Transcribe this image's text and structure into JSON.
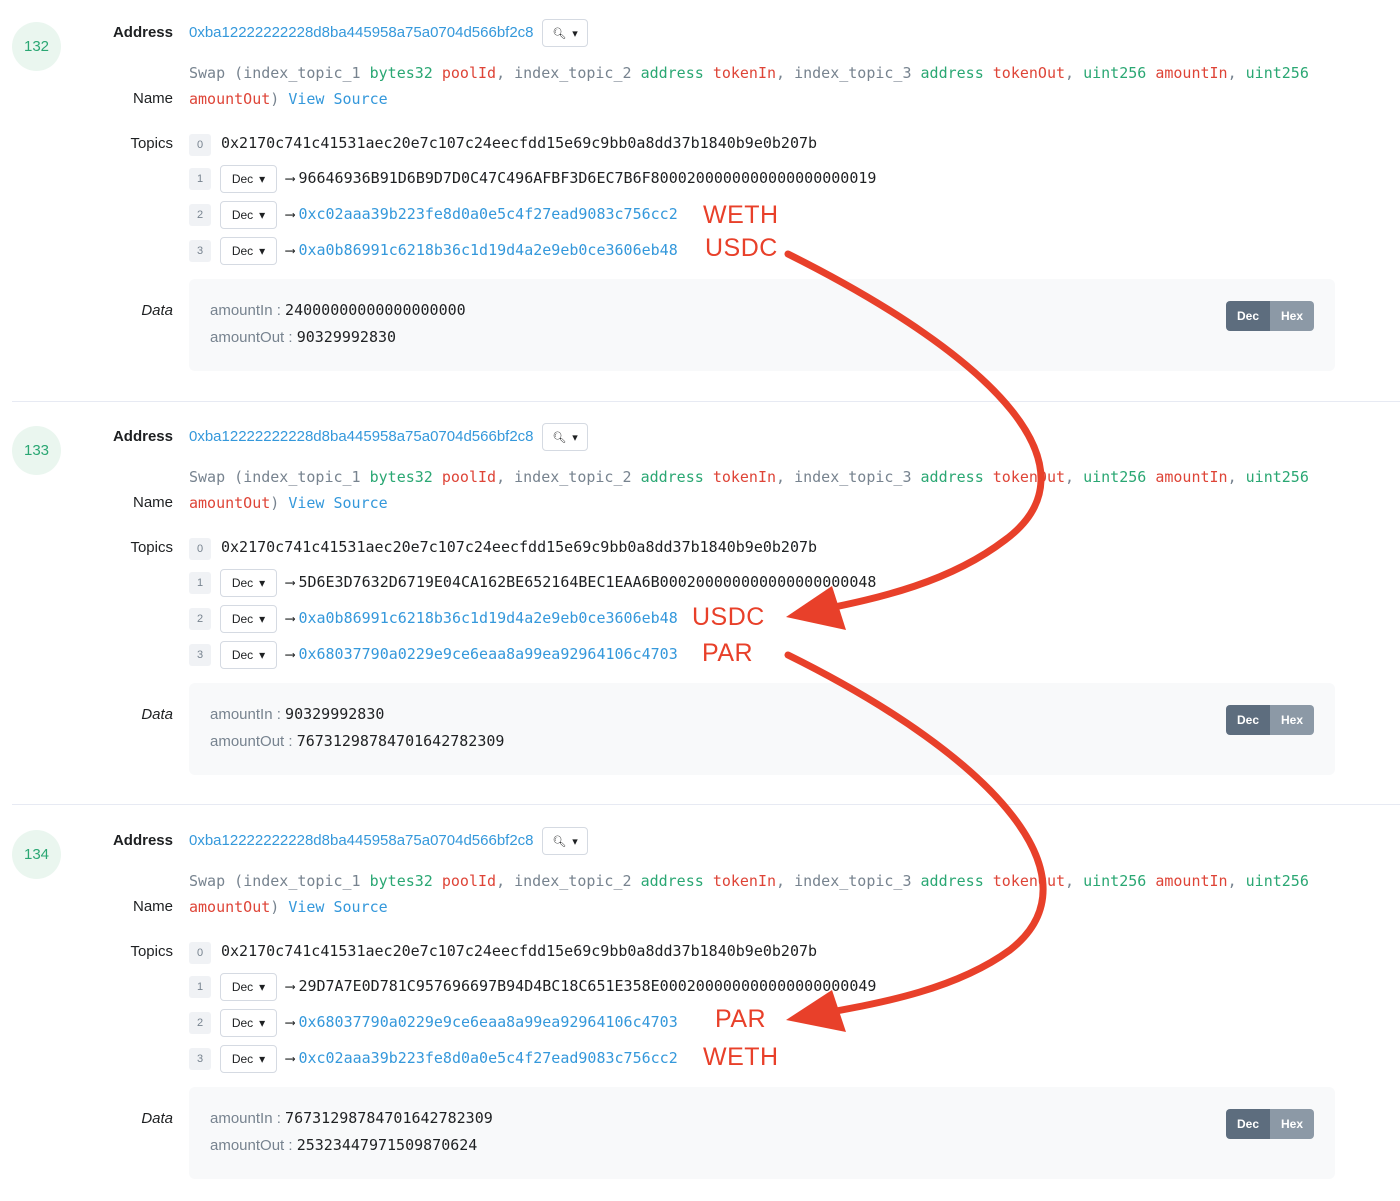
{
  "labels": {
    "address": "Address",
    "name": "Name",
    "topics": "Topics",
    "data": "Data",
    "dec": "Dec",
    "hex": "Hex",
    "view_source": "View Source"
  },
  "icons": {
    "zoom": "magnifier-icon",
    "caret": "chevron-down-icon",
    "topic_arrow": "long-right-arrow-icon"
  },
  "colors": {
    "link": "#3498db",
    "type": "#2aa773",
    "param": "#de4437",
    "annotation": "#e8402a"
  },
  "signature": {
    "fn": "Swap (",
    "p1_idx": "index_topic_1 ",
    "p1_type": "bytes32",
    "p1_name": "poolId",
    "p2_idx": "index_topic_2 ",
    "p2_type": "address",
    "p2_name": "tokenIn",
    "p3_idx": "index_topic_3 ",
    "p3_type": "address",
    "p3_name": "tokenOut",
    "p4_type": "uint256",
    "p4_name": "amountIn",
    "p5_type": "uint256",
    "p5_name": "amountOut",
    "sep": ", ",
    "close": ")"
  },
  "logs": [
    {
      "index": "132",
      "address": "0xba12222222228d8ba445958a75a0704d566bf2c8",
      "topics": [
        "0x2170c741c41531aec20e7c107c24eecfdd15e69c9bb0a8dd37b1840b9e0b207b",
        "96646936B91D6B9D7D0C47C496AFBF3D6EC7B6F8000200000000000000000019",
        "0xc02aaa39b223fe8d0a0e5c4f27ead9083c756cc2",
        "0xa0b86991c6218b36c1d19d4a2e9eb0ce3606eb48"
      ],
      "tokens": [
        "WETH",
        "USDC"
      ],
      "data": {
        "amountIn": "24000000000000000000",
        "amountOut": "90329992830"
      }
    },
    {
      "index": "133",
      "address": "0xba12222222228d8ba445958a75a0704d566bf2c8",
      "topics": [
        "0x2170c741c41531aec20e7c107c24eecfdd15e69c9bb0a8dd37b1840b9e0b207b",
        "5D6E3D7632D6719E04CA162BE652164BEC1EAA6B000200000000000000000048",
        "0xa0b86991c6218b36c1d19d4a2e9eb0ce3606eb48",
        "0x68037790a0229e9ce6eaa8a99ea92964106c4703"
      ],
      "tokens": [
        "USDC",
        "PAR"
      ],
      "data": {
        "amountIn": "90329992830",
        "amountOut": "76731298784701642782309"
      }
    },
    {
      "index": "134",
      "address": "0xba12222222228d8ba445958a75a0704d566bf2c8",
      "topics": [
        "0x2170c741c41531aec20e7c107c24eecfdd15e69c9bb0a8dd37b1840b9e0b207b",
        "29D7A7E0D781C957696697B94D4BC18C651E358E000200000000000000000049",
        "0x68037790a0229e9ce6eaa8a99ea92964106c4703",
        "0xc02aaa39b223fe8d0a0e5c4f27ead9083c756cc2"
      ],
      "tokens": [
        "PAR",
        "WETH"
      ],
      "data": {
        "amountIn": "76731298784701642782309",
        "amountOut": "25323447971509870624"
      }
    }
  ]
}
